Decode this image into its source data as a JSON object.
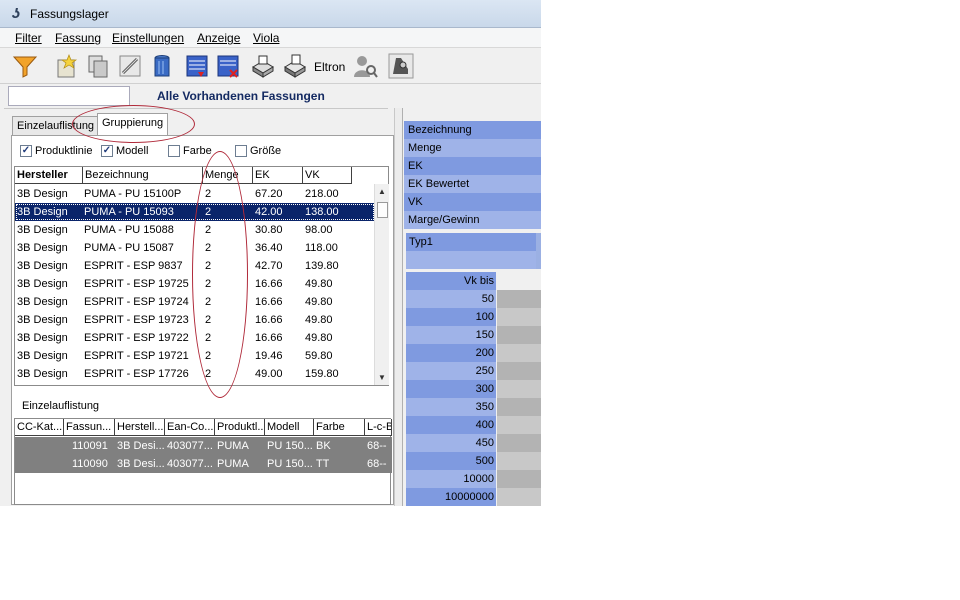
{
  "window": {
    "title": "Fassungslager",
    "app_icon": "app-logo-icon"
  },
  "menu": [
    {
      "label": "Filter"
    },
    {
      "label": "Fassung"
    },
    {
      "label": "Einstellungen"
    },
    {
      "label": "Anzeige"
    },
    {
      "label": "Viola"
    }
  ],
  "toolbar": {
    "icons": [
      "funnel-icon",
      "new-star-icon",
      "copy-icon",
      "edit-pencil-icon",
      "trash-bin-icon",
      "list-icon",
      "list-delete-icon",
      "print-icon",
      "print-alt-icon",
      "person-search-icon",
      "label-printer-icon"
    ],
    "eltron_label": "Eltron"
  },
  "header": {
    "input_value": "",
    "title": "Alle Vorhandenen Fassungen"
  },
  "tabs": [
    {
      "label": "Einzelauflistung",
      "active": false
    },
    {
      "label": "Gruppierung",
      "active": true
    }
  ],
  "checkboxes": [
    {
      "label": "Produktlinie",
      "checked": true
    },
    {
      "label": "Modell",
      "checked": true
    },
    {
      "label": "Farbe",
      "checked": false
    },
    {
      "label": "Größe",
      "checked": false
    }
  ],
  "grid1": {
    "columns": [
      "Hersteller",
      "Bezeichnung",
      "Menge",
      "EK",
      "VK"
    ],
    "rows": [
      [
        "3B Design",
        "PUMA - PU 15100P",
        "2",
        "67.20",
        "218.00"
      ],
      [
        "3B Design",
        "PUMA - PU 15093",
        "2",
        "42.00",
        "138.00"
      ],
      [
        "3B Design",
        "PUMA - PU 15088",
        "2",
        "30.80",
        "98.00"
      ],
      [
        "3B Design",
        "PUMA - PU 15087",
        "2",
        "36.40",
        "118.00"
      ],
      [
        "3B Design",
        "ESPRIT - ESP 9837",
        "2",
        "42.70",
        "139.80"
      ],
      [
        "3B Design",
        "ESPRIT - ESP 19725",
        "2",
        "16.66",
        "49.80"
      ],
      [
        "3B Design",
        "ESPRIT - ESP 19724",
        "2",
        "16.66",
        "49.80"
      ],
      [
        "3B Design",
        "ESPRIT - ESP 19723",
        "2",
        "16.66",
        "49.80"
      ],
      [
        "3B Design",
        "ESPRIT - ESP 19722",
        "2",
        "16.66",
        "49.80"
      ],
      [
        "3B Design",
        "ESPRIT - ESP 19721",
        "2",
        "19.46",
        "59.80"
      ],
      [
        "3B Design",
        "ESPRIT - ESP 17726",
        "2",
        "49.00",
        "159.80"
      ]
    ],
    "selected_row": 1
  },
  "subgrid": {
    "label": "Einzelauflistung",
    "columns": [
      "CC-Kat...",
      "Fassun...",
      "Herstell...",
      "Ean-Co...",
      "Produktl...",
      "Modell",
      "Farbe",
      "L-c-B"
    ],
    "rows": [
      [
        "",
        "110091",
        "3B Desi...",
        "403077...",
        "PUMA",
        "PU 150...",
        "BK",
        "68--"
      ],
      [
        "",
        "110090",
        "3B Desi...",
        "403077...",
        "PUMA",
        "PU 150...",
        "TT",
        "68--"
      ]
    ]
  },
  "right_panel": {
    "fields": [
      "Bezeichnung",
      "Menge",
      "EK",
      "EK Bewertet",
      "VK",
      "Marge/Gewinn"
    ],
    "typ": [
      "Typ1",
      ""
    ],
    "vk_header": "Vk bis",
    "vk_bis": [
      "50",
      "100",
      "150",
      "200",
      "250",
      "300",
      "350",
      "400",
      "450",
      "500",
      "10000",
      "10000000"
    ]
  },
  "colors": {
    "selection": "#0a246a",
    "panel_blue_dark": "#7f9ae0",
    "panel_blue_light": "#9fb3e8",
    "annotation": "#b02a3a"
  }
}
